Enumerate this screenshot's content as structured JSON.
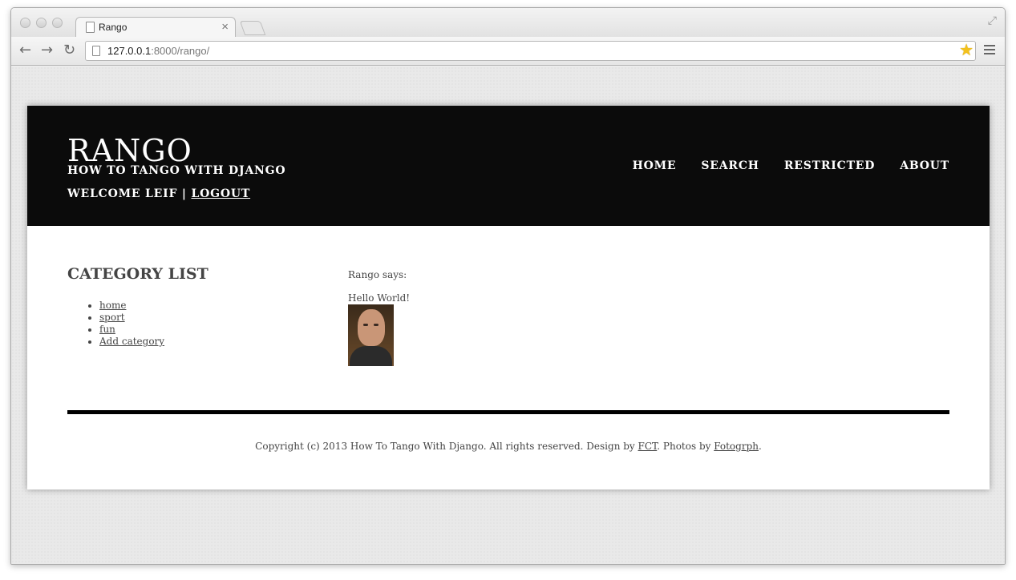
{
  "browser": {
    "tab_title": "Rango",
    "tab_close": "×",
    "url_host": "127.0.0.1",
    "url_rest": ":8000/rango/",
    "back": "←",
    "forward": "→",
    "reload": "↻",
    "star": "★",
    "fullscreen": "⤢"
  },
  "header": {
    "title": "RANGO",
    "subtitle": "HOW TO TANGO WITH DJANGO",
    "welcome": "WELCOME LEIF | ",
    "logout": "LOGOUT",
    "nav": [
      "HOME",
      "SEARCH",
      "RESTRICTED",
      "ABOUT"
    ]
  },
  "sidebar": {
    "title": "CATEGORY LIST",
    "categories": [
      "home",
      "sport",
      "fun",
      "Add category"
    ]
  },
  "main": {
    "rango_says": "Rango says:",
    "hello": "Hello World!"
  },
  "footer": {
    "prefix": "Copyright (c) 2013 How To Tango With Django. All rights reserved. Design by ",
    "fct": "FCT",
    "middle": ". Photos by ",
    "fotogrph": "Fotogrph",
    "suffix": "."
  }
}
